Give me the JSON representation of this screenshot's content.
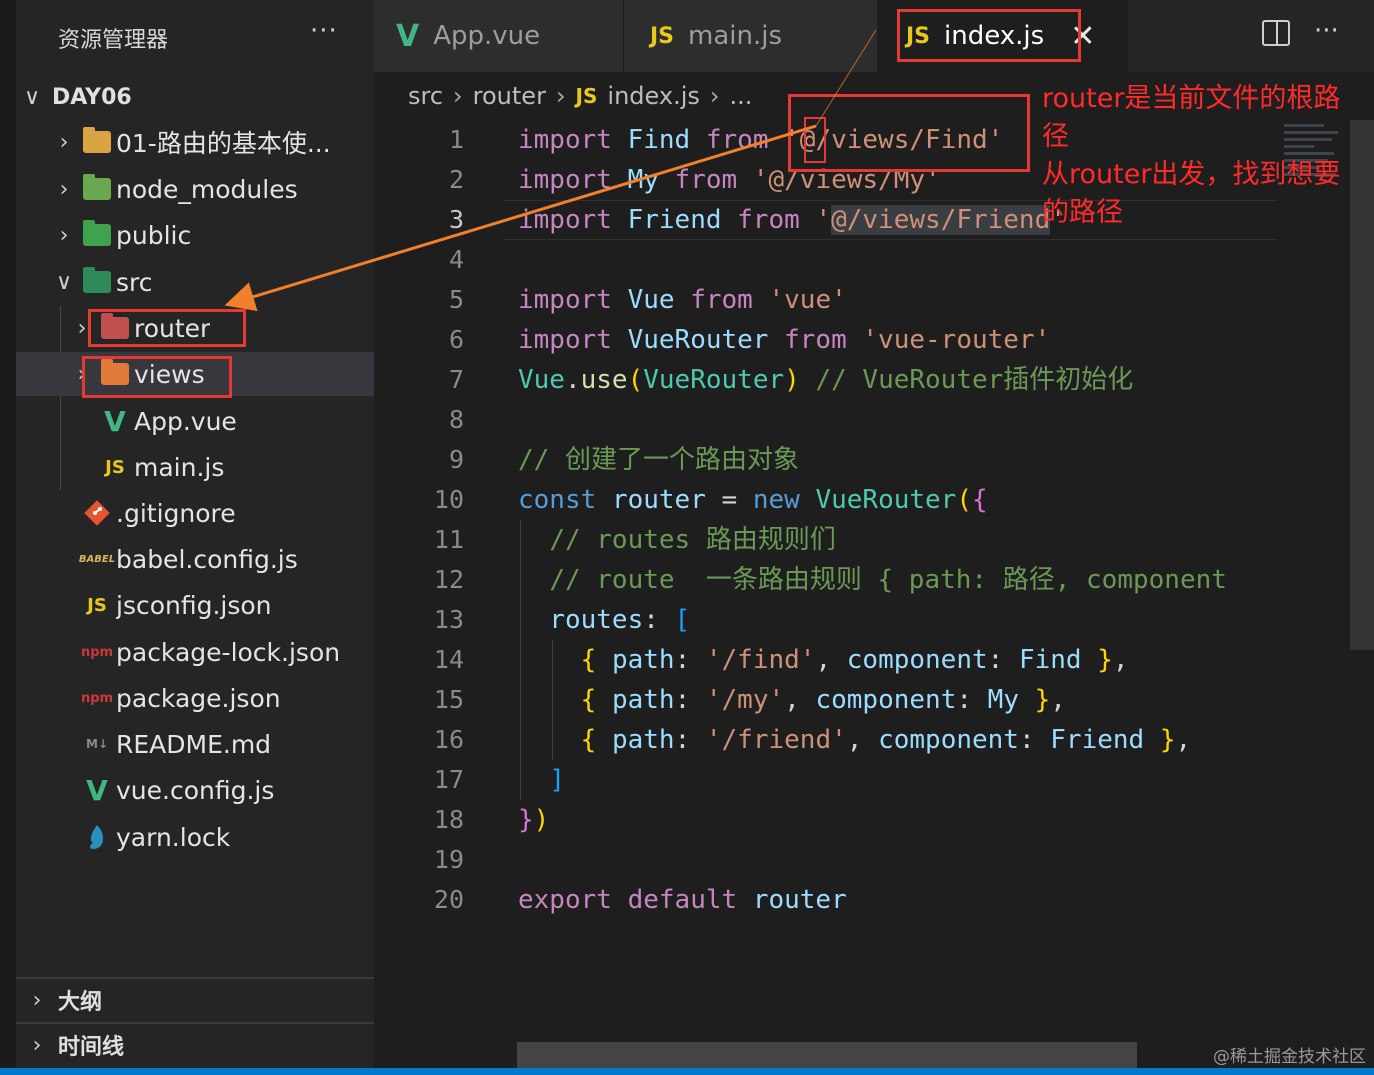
{
  "sidebar": {
    "title": "资源管理器",
    "more": "···",
    "root": {
      "chevron": "∨",
      "label": "DAY06"
    },
    "items": [
      {
        "chevron": "›",
        "label": "01-路由的基本使...",
        "icon": "folder-icon"
      },
      {
        "chevron": "›",
        "label": "node_modules",
        "icon": "node-folder-icon"
      },
      {
        "chevron": "›",
        "label": "public",
        "icon": "public-folder-icon"
      },
      {
        "chevron": "∨",
        "label": "src",
        "icon": "src-folder-icon"
      },
      {
        "chevron": "›",
        "label": "router",
        "icon": "router-folder-icon"
      },
      {
        "chevron": "›",
        "label": "views",
        "icon": "views-folder-icon"
      },
      {
        "chevron": "",
        "label": "App.vue",
        "icon": "vue-icon",
        "icon_text": "V"
      },
      {
        "chevron": "",
        "label": "main.js",
        "icon": "js-icon",
        "icon_text": "JS"
      },
      {
        "chevron": "",
        "label": ".gitignore",
        "icon": "git-icon"
      },
      {
        "chevron": "",
        "label": "babel.config.js",
        "icon": "babel-icon",
        "icon_text": "BABEL"
      },
      {
        "chevron": "",
        "label": "jsconfig.json",
        "icon": "js-icon",
        "icon_text": "JS"
      },
      {
        "chevron": "",
        "label": "package-lock.json",
        "icon": "npm-icon",
        "icon_text": "npm"
      },
      {
        "chevron": "",
        "label": "package.json",
        "icon": "npm-icon",
        "icon_text": "npm"
      },
      {
        "chevron": "",
        "label": "README.md",
        "icon": "markdown-icon",
        "icon_text": "M↓"
      },
      {
        "chevron": "",
        "label": "vue.config.js",
        "icon": "vue-config-icon",
        "icon_text": "V"
      },
      {
        "chevron": "",
        "label": "yarn.lock",
        "icon": "yarn-icon"
      }
    ],
    "sections": [
      {
        "chevron": "›",
        "label": "大纲"
      },
      {
        "chevron": "›",
        "label": "时间线"
      }
    ]
  },
  "tabs": [
    {
      "icon_text": "V",
      "label": "App.vue",
      "active": false
    },
    {
      "icon_text": "JS",
      "label": "main.js",
      "active": false
    },
    {
      "icon_text": "JS",
      "label": "index.js",
      "active": true,
      "close": "✕"
    }
  ],
  "tab_more": "···",
  "breadcrumb": {
    "parts": [
      "src",
      "router"
    ],
    "file_icon": "JS",
    "file": "index.js",
    "ellipsis": "..."
  },
  "editor": {
    "line_numbers": [
      "1",
      "2",
      "3",
      "4",
      "5",
      "6",
      "7",
      "8",
      "9",
      "10",
      "11",
      "12",
      "13",
      "14",
      "15",
      "16",
      "17",
      "18",
      "19",
      "20"
    ],
    "current_line": 3
  },
  "annotations": {
    "note_line1": "router是当前文件的根路",
    "note_line2": "径",
    "note_line3": "从router出发，找到想要",
    "note_line4": "的路径"
  },
  "watermark": "@稀土掘金技术社区",
  "colors": {
    "accent_red": "#e53935",
    "arrow_orange": "#f0812a",
    "vue_green": "#41b883",
    "js_yellow": "#e8c81f",
    "status_blue": "#007acc"
  }
}
